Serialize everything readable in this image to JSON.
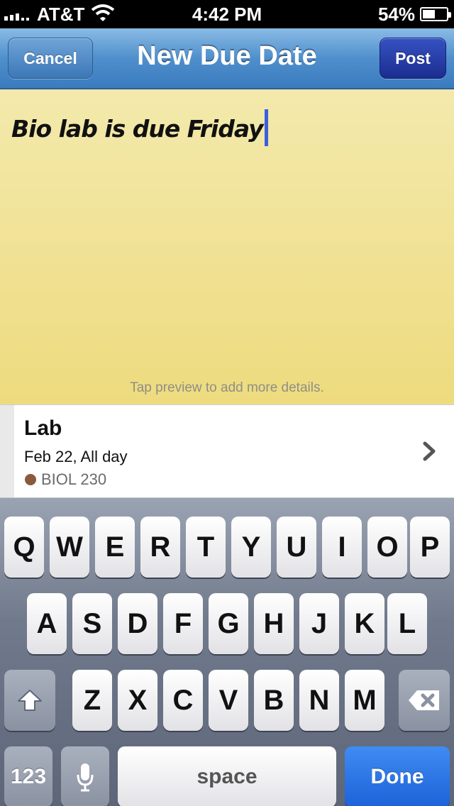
{
  "status_bar": {
    "carrier": "AT&T",
    "time": "4:42 PM",
    "battery": "54%",
    "battery_level": 0.54
  },
  "nav": {
    "title": "New Due Date",
    "cancel_label": "Cancel",
    "post_label": "Post"
  },
  "note": {
    "text": "Bio lab is due Friday",
    "hint": "Tap preview to add more details."
  },
  "detail": {
    "title": "Lab",
    "date": "Feb 22, All day",
    "course": "BIOL 230",
    "course_color": "#8a5a3c"
  },
  "keyboard": {
    "row1": [
      "Q",
      "W",
      "E",
      "R",
      "T",
      "Y",
      "U",
      "I",
      "O",
      "P"
    ],
    "row2": [
      "A",
      "S",
      "D",
      "F",
      "G",
      "H",
      "J",
      "K",
      "L"
    ],
    "row3": [
      "Z",
      "X",
      "C",
      "V",
      "B",
      "N",
      "M"
    ],
    "numbers_label": "123",
    "space_label": "space",
    "done_label": "Done",
    "shift_icon": "shift-icon",
    "delete_icon": "delete-icon",
    "mic_icon": "microphone-icon"
  }
}
